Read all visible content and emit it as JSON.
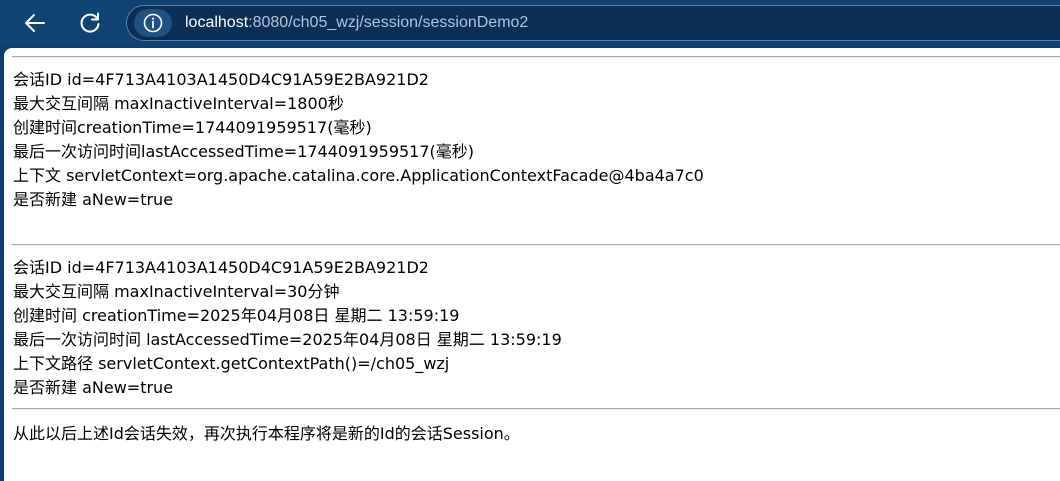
{
  "browser": {
    "url_host": "localhost",
    "url_rest": ":8080/ch05_wzj/session/sessionDemo2"
  },
  "page": {
    "section1": [
      "会话ID id=4F713A4103A1450D4C91A59E2BA921D2",
      "最大交互间隔 maxInactiveInterval=1800秒",
      "创建时间creationTime=1744091959517(毫秒)",
      "最后一次访问时间lastAccessedTime=1744091959517(毫秒)",
      "上下文 servletContext=org.apache.catalina.core.ApplicationContextFacade@4ba4a7c0",
      "是否新建 aNew=true"
    ],
    "section2": [
      "会话ID id=4F713A4103A1450D4C91A59E2BA921D2",
      "最大交互间隔 maxInactiveInterval=30分钟",
      "创建时间 creationTime=2025年04月08日 星期二 13:59:19",
      "最后一次访问时间 lastAccessedTime=2025年04月08日 星期二 13:59:19",
      "上下文路径 servletContext.getContextPath()=/ch05_wzj",
      "是否新建 aNew=true"
    ],
    "footer_message": "从此以后上述Id会话失效，再次执行本程序将是新的Id的会话Session。"
  }
}
